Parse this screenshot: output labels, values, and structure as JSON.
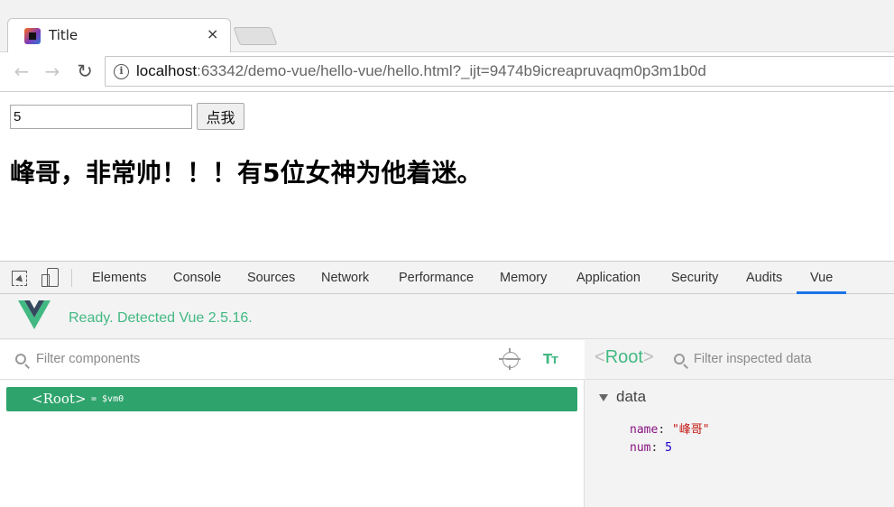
{
  "browser": {
    "tab_title": "Title",
    "tab_close": "×",
    "url_host": "localhost",
    "url_rest": ":63342/demo-vue/hello-vue/hello.html?_ijt=9474b9icreapruvaqm0p3m1b0d"
  },
  "page": {
    "input_value": "5",
    "button_label": "点我",
    "heading": "峰哥，非常帅！！！有5位女神为他着迷。"
  },
  "devtools": {
    "tabs": [
      "Elements",
      "Console",
      "Sources",
      "Network",
      "Performance",
      "Memory",
      "Application",
      "Security",
      "Audits",
      "Vue"
    ],
    "active_tab": "Vue",
    "vue_status": "Ready. Detected Vue 2.5.16.",
    "filter_components_placeholder": "Filter components",
    "root_component": "<Root>",
    "root_vm": "= $vm0",
    "root_label_open": "<",
    "root_label_name": "Root",
    "root_label_close": ">",
    "filter_inspected_placeholder": "Filter inspected data",
    "data_section": "data",
    "data_props": [
      {
        "key": "name",
        "value": "\"峰哥\""
      },
      {
        "key": "num",
        "value": "5"
      }
    ],
    "colors": {
      "vue_green": "#42b983",
      "selected_row": "#2ea36c",
      "active_tab_underline": "#1a73e8"
    },
    "icons": [
      "inspect-icon",
      "device-toggle-icon",
      "search-icon",
      "target-icon",
      "text-size-icon",
      "vue-logo"
    ]
  }
}
